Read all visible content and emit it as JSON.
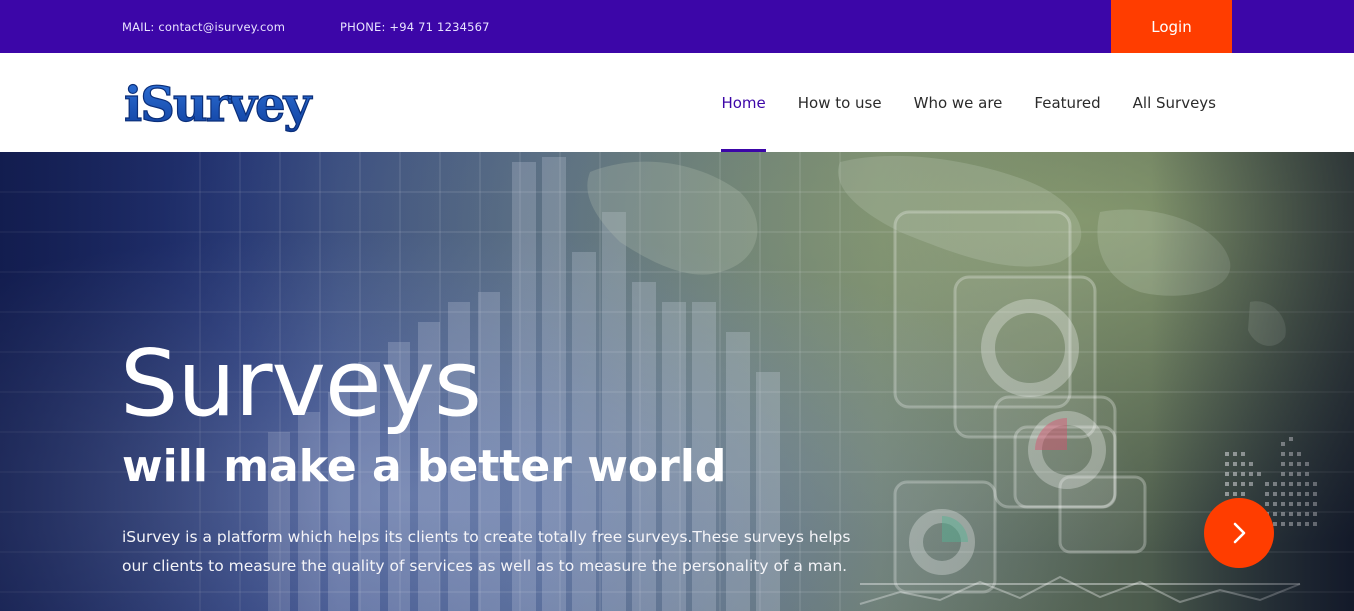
{
  "topbar": {
    "mail": "MAIL: contact@isurvey.com",
    "phone": "PHONE: +94 71 1234567",
    "login_label": "Login"
  },
  "logo": {
    "text": "iSurvey"
  },
  "nav": {
    "items": [
      {
        "label": "Home",
        "active": true
      },
      {
        "label": "How to use",
        "active": false
      },
      {
        "label": "Who we are",
        "active": false
      },
      {
        "label": "Featured",
        "active": false
      },
      {
        "label": "All Surveys",
        "active": false
      }
    ]
  },
  "hero": {
    "title": "Surveys",
    "subtitle": "will make a better world",
    "description": "iSurvey is a platform which helps its clients to create totally free surveys.These surveys helps our clients to measure the quality of services as well as to measure the personality of a man.",
    "next_icon": "chevron-right-icon"
  },
  "colors": {
    "brand_purple": "#3c06a8",
    "accent_orange": "#ff3d00",
    "logo_blue": "#1f5fc9"
  }
}
